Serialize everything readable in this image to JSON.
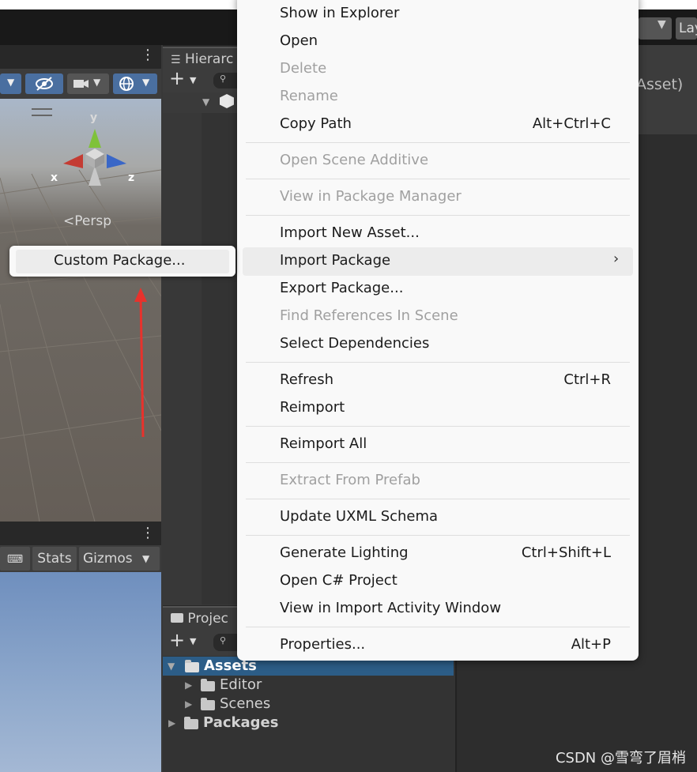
{
  "hierarchy": {
    "tab_label": "Hierarc"
  },
  "project": {
    "tab_label": "Projec",
    "tree": [
      {
        "label": "Assets",
        "bold": true
      },
      {
        "label": "Editor",
        "bold": false
      },
      {
        "label": "Scenes",
        "bold": false
      },
      {
        "label": "Packages",
        "bold": true
      }
    ]
  },
  "scene": {
    "persp_label": "Persp",
    "axis_x": "x",
    "axis_y": "y",
    "axis_z": "z"
  },
  "game": {
    "stats_label": "Stats",
    "gizmos_label": "Gizmos"
  },
  "inspector": {
    "asset_text": "Asset)",
    "layers_label": "Lay"
  },
  "context_menu": {
    "items": {
      "show_in_explorer": "Show in Explorer",
      "open": "Open",
      "delete": "Delete",
      "rename": "Rename",
      "copy_path": "Copy Path",
      "copy_path_shortcut": "Alt+Ctrl+C",
      "open_scene_additive": "Open Scene Additive",
      "view_in_package_manager": "View in Package Manager",
      "import_new_asset": "Import New Asset...",
      "import_package": "Import Package",
      "export_package": "Export Package...",
      "find_references": "Find References In Scene",
      "select_dependencies": "Select Dependencies",
      "refresh": "Refresh",
      "refresh_shortcut": "Ctrl+R",
      "reimport": "Reimport",
      "reimport_all": "Reimport All",
      "extract_from_prefab": "Extract From Prefab",
      "update_uxml_schema": "Update UXML Schema",
      "generate_lighting": "Generate Lighting",
      "generate_lighting_shortcut": "Ctrl+Shift+L",
      "open_csharp_project": "Open C# Project",
      "view_in_import_activity": "View in Import Activity Window",
      "properties": "Properties...",
      "properties_shortcut": "Alt+P"
    }
  },
  "submenu": {
    "custom_package": "Custom Package..."
  },
  "watermark": "CSDN @雪弯了眉梢",
  "colors": {
    "menu_bg": "#f9f9f9",
    "selection": "#2c5d87",
    "arrow": "#e8322c"
  }
}
